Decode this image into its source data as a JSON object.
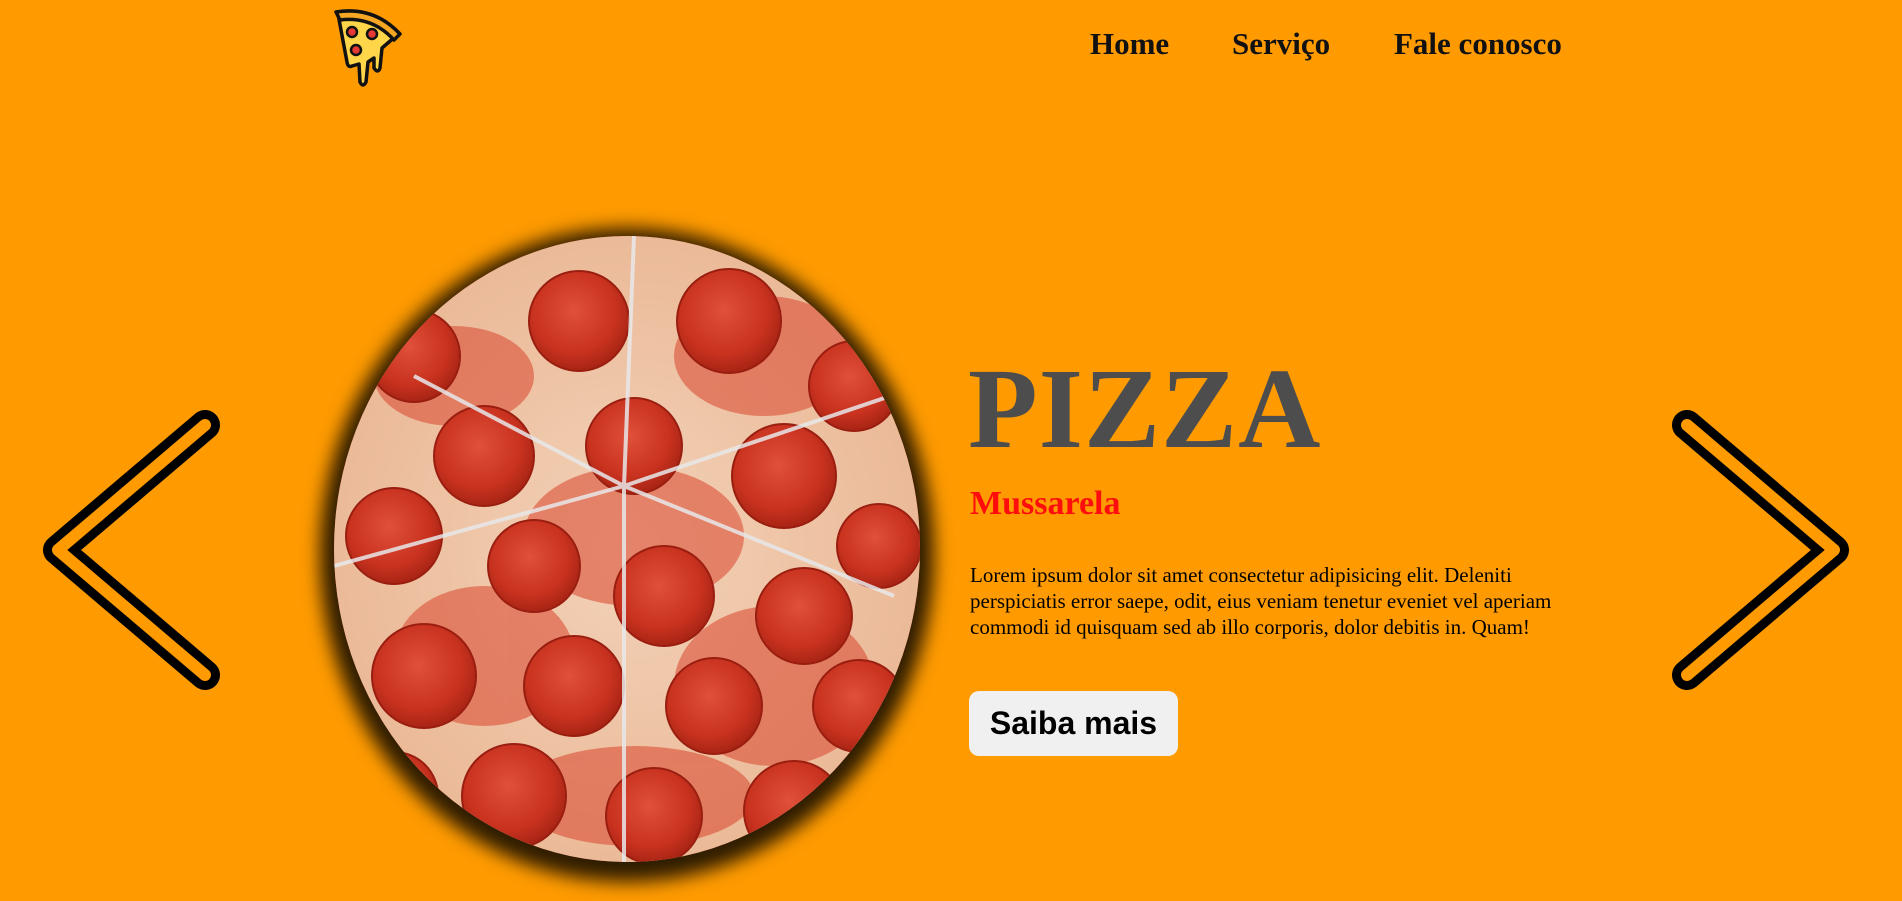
{
  "header": {
    "logo_icon": "pizza-slice-icon",
    "nav": [
      {
        "label": "Home"
      },
      {
        "label": "Serviço"
      },
      {
        "label": "Fale conosco"
      }
    ]
  },
  "slider": {
    "prev_icon": "chevron-left-icon",
    "next_icon": "chevron-right-icon"
  },
  "hero": {
    "image": "pepperoni-pizza-image",
    "title": "PIZZA",
    "subtitle": "Mussarela",
    "description": "Lorem ipsum dolor sit amet consectetur adipisicing elit. Deleniti perspiciatis error saepe, odit, eius veniam tenetur eveniet vel aperiam commodi id quisquam sed ab illo corporis, dolor debitis in. Quam!",
    "button_label": "Saiba mais"
  },
  "colors": {
    "background": "#ff9b00",
    "title": "#4d4d4d",
    "subtitle": "#ff0d0d",
    "button_bg": "#f0f0f0"
  }
}
